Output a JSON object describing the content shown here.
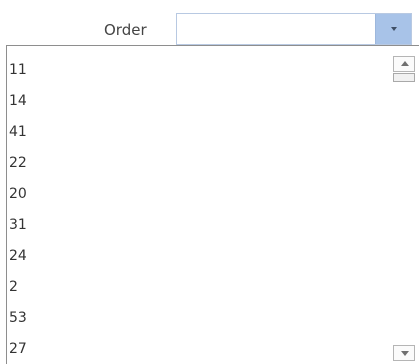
{
  "field": {
    "label": "Order",
    "value": ""
  },
  "list": {
    "items": [
      "11",
      "14",
      "41",
      "22",
      "20",
      "31",
      "24",
      "2",
      "53",
      "27"
    ]
  },
  "icons": {
    "combo_dropdown": "chevron-down-icon",
    "scroll_up": "arrow-up-icon",
    "scroll_down": "arrow-down-icon"
  },
  "colors": {
    "combo_button": "#a8c3e8",
    "combo_border": "#b8c9e2",
    "list_border": "#8e8e8e"
  }
}
